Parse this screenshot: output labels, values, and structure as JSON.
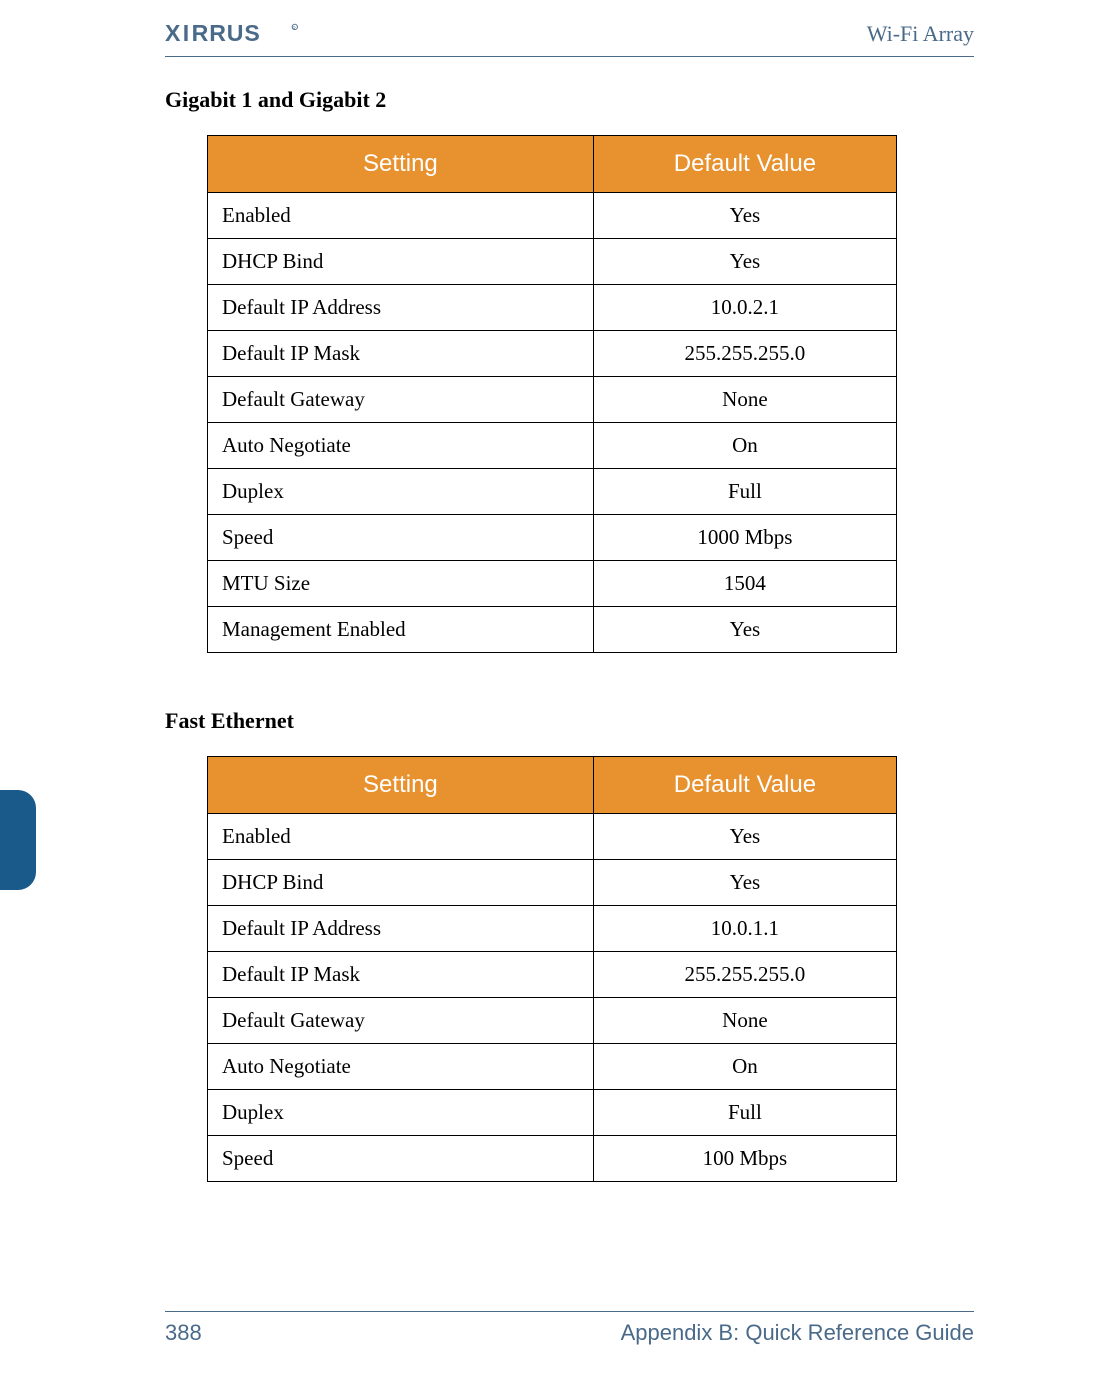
{
  "header": {
    "title": "Wi-Fi Array",
    "logo_text": "XIRRUS"
  },
  "section1": {
    "title": "Gigabit 1 and Gigabit 2",
    "columns": [
      "Setting",
      "Default Value"
    ],
    "rows": [
      {
        "setting": "Enabled",
        "value": "Yes"
      },
      {
        "setting": "DHCP Bind",
        "value": "Yes"
      },
      {
        "setting": "Default IP Address",
        "value": "10.0.2.1"
      },
      {
        "setting": "Default IP Mask",
        "value": "255.255.255.0"
      },
      {
        "setting": "Default Gateway",
        "value": "None"
      },
      {
        "setting": "Auto Negotiate",
        "value": "On"
      },
      {
        "setting": "Duplex",
        "value": "Full"
      },
      {
        "setting": "Speed",
        "value": "1000 Mbps"
      },
      {
        "setting": "MTU Size",
        "value": "1504"
      },
      {
        "setting": "Management Enabled",
        "value": "Yes"
      }
    ]
  },
  "section2": {
    "title": "Fast Ethernet",
    "columns": [
      "Setting",
      "Default Value"
    ],
    "rows": [
      {
        "setting": "Enabled",
        "value": "Yes"
      },
      {
        "setting": "DHCP Bind",
        "value": "Yes"
      },
      {
        "setting": "Default IP Address",
        "value": "10.0.1.1"
      },
      {
        "setting": "Default IP Mask",
        "value": "255.255.255.0"
      },
      {
        "setting": "Default Gateway",
        "value": "None"
      },
      {
        "setting": "Auto Negotiate",
        "value": "On"
      },
      {
        "setting": "Duplex",
        "value": "Full"
      },
      {
        "setting": "Speed",
        "value": "100 Mbps"
      }
    ]
  },
  "footer": {
    "page": "388",
    "label": "Appendix B: Quick Reference Guide"
  }
}
